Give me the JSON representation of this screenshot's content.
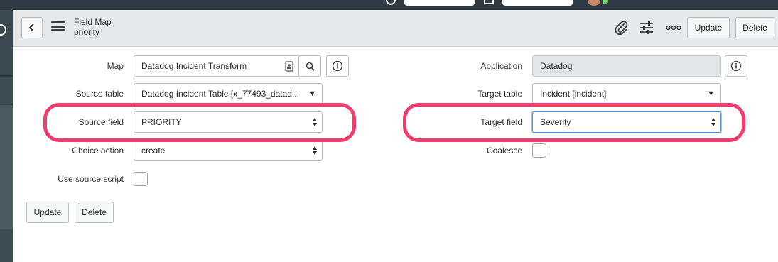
{
  "header": {
    "title": "Field Map",
    "subtitle": "priority",
    "update_label": "Update",
    "delete_label": "Delete",
    "icons": [
      "back-icon",
      "hamburger-icon",
      "paperclip-icon",
      "sliders-icon",
      "more-icon"
    ]
  },
  "form": {
    "map": {
      "label": "Map",
      "value": "Datadog Incident Transform"
    },
    "source_table": {
      "label": "Source table",
      "value": "Datadog Incident Table [x_77493_datad..."
    },
    "source_field": {
      "label": "Source field",
      "value": "PRIORITY"
    },
    "choice_action": {
      "label": "Choice action",
      "value": "create"
    },
    "use_source_script": {
      "label": "Use source script",
      "checked": false
    },
    "application": {
      "label": "Application",
      "value": "Datadog"
    },
    "target_table": {
      "label": "Target table",
      "value": "Incident [incident]"
    },
    "target_field": {
      "label": "Target field",
      "value": "Severity"
    },
    "coalesce": {
      "label": "Coalesce",
      "checked": false
    }
  },
  "footer": {
    "update_label": "Update",
    "delete_label": "Delete"
  },
  "colors": {
    "highlight": "#f03d6d",
    "header_bg": "#e6e8ea",
    "nav_dark": "#2f3a42"
  }
}
